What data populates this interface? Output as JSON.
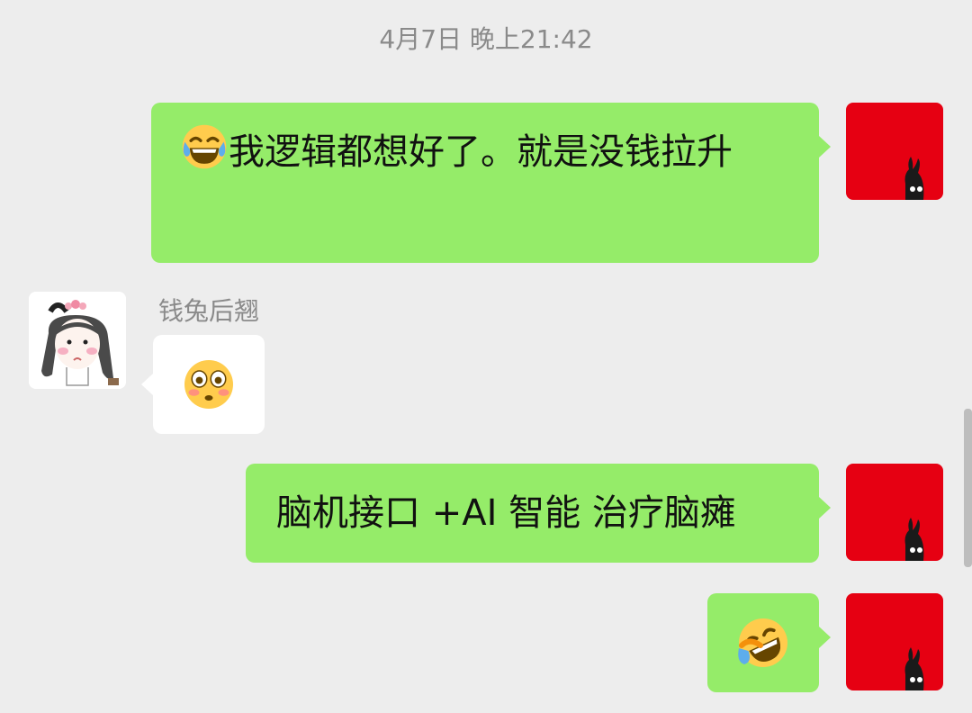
{
  "timestamp": "4月7日 晚上21:42",
  "messages": [
    {
      "id": "m1",
      "from": "me",
      "emoji": "face-with-tears-of-joy",
      "text": "我逻辑都想好了。就是没钱拉升"
    },
    {
      "id": "m2",
      "from": "them",
      "sender": "钱兔后翘",
      "emoji": "flushed-face",
      "text": ""
    },
    {
      "id": "m3",
      "from": "me",
      "text": "脑机接口 +AI 智能 治疗脑瘫"
    },
    {
      "id": "m4",
      "from": "me",
      "emoji": "rolling-on-floor-laughing",
      "text": ""
    }
  ],
  "colors": {
    "background": "#ededed",
    "my_bubble": "#95ec69",
    "their_bubble": "#ffffff",
    "my_avatar": "#e60012",
    "meta_text": "#8a8a8a"
  }
}
